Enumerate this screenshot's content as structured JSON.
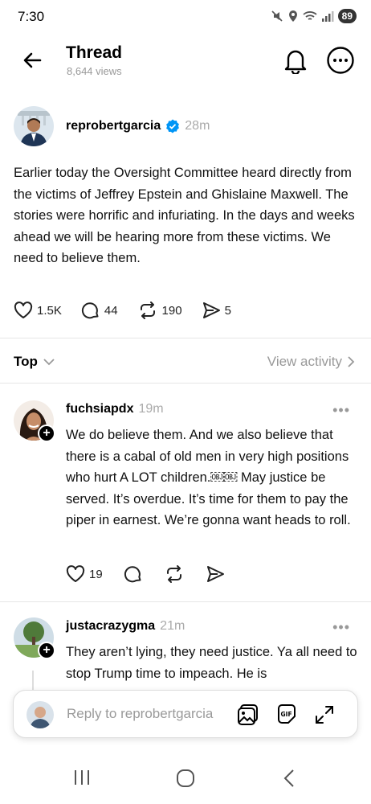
{
  "status_bar": {
    "time": "7:30",
    "battery": "89"
  },
  "header": {
    "title": "Thread",
    "views": "8,644 views"
  },
  "post": {
    "author": "reprobertgarcia",
    "time": "28m",
    "text": "Earlier today the Oversight Committee heard directly from the victims of Jeffrey Epstein and Ghislaine Maxwell. The stories were horrific and infuriating. In the days and weeks ahead we will be hearing more from these victims. We need to believe them.",
    "likes": "1.5K",
    "comments": "44",
    "reposts": "190",
    "shares": "5"
  },
  "sort": {
    "label": "Top",
    "view_activity": "View activity"
  },
  "replies": [
    {
      "author": "fuchsiapdx",
      "time": "19m",
      "text": "We do believe them. And we also believe that there is a cabal of old men in very high positions who hurt A LOT  children.￼￼ May justice be served. It’s overdue. It’s time for them to pay the piper in earnest. We’re gonna want heads to roll.",
      "likes": "19"
    },
    {
      "author": "justacrazygma",
      "time": "21m",
      "text": "They aren’t lying, they need justice. Ya all need to stop Trump time to impeach. He is"
    }
  ],
  "composer": {
    "placeholder": "Reply to reprobertgarcia"
  },
  "icons": {
    "back": "arrow-left-icon",
    "bell": "bell-icon",
    "more": "more-circle-icon",
    "like": "heart-icon",
    "comment": "comment-icon",
    "repost": "repost-icon",
    "share": "send-icon",
    "image": "image-icon",
    "gif": "gif-icon",
    "expand": "expand-icon"
  },
  "colors": {
    "verified": "#0095f6",
    "muted": "#999999"
  }
}
